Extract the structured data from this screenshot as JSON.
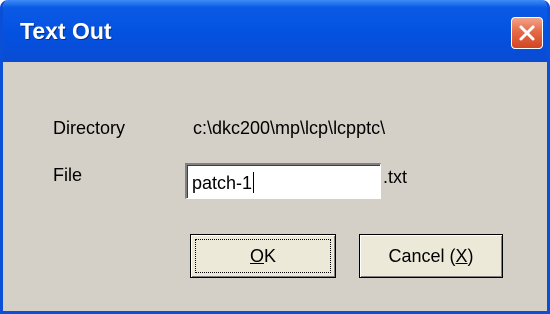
{
  "window": {
    "title": "Text Out",
    "close_icon": "close-x-icon"
  },
  "directory": {
    "label": "Directory",
    "value": "c:\\dkc200\\mp\\lcp\\lcpptc\\"
  },
  "file": {
    "label": "File",
    "value": "patch-1",
    "extension": ".txt"
  },
  "buttons": {
    "ok": {
      "mnemonic": "O",
      "rest": "K"
    },
    "cancel": {
      "prefix": "Cancel (",
      "mnemonic": "X",
      "suffix": ")"
    }
  },
  "colors": {
    "titlebar": "#0451e0",
    "dialog_face": "#d4d0c8",
    "close_button": "#e56a47"
  }
}
